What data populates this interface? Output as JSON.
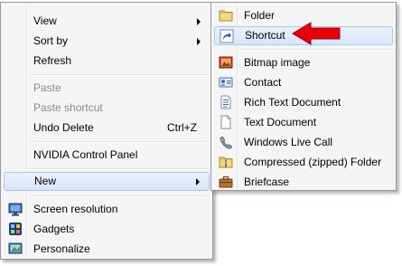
{
  "context_menu": {
    "items": [
      {
        "label": "View",
        "has_submenu": true
      },
      {
        "label": "Sort by",
        "has_submenu": true
      },
      {
        "label": "Refresh"
      },
      {
        "label": "Paste",
        "disabled": true
      },
      {
        "label": "Paste shortcut",
        "disabled": true
      },
      {
        "label": "Undo Delete",
        "shortcut": "Ctrl+Z"
      },
      {
        "label": "NVIDIA Control Panel"
      },
      {
        "label": "New",
        "has_submenu": true,
        "selected": true
      },
      {
        "label": "Screen resolution",
        "icon": "monitor-icon"
      },
      {
        "label": "Gadgets",
        "icon": "gadgets-icon"
      },
      {
        "label": "Personalize",
        "icon": "personalize-icon"
      }
    ]
  },
  "new_submenu": {
    "items": [
      {
        "label": "Folder",
        "icon": "folder-icon"
      },
      {
        "label": "Shortcut",
        "icon": "shortcut-icon",
        "selected": true
      },
      {
        "label": "Bitmap image",
        "icon": "bitmap-icon"
      },
      {
        "label": "Contact",
        "icon": "contact-icon"
      },
      {
        "label": "Rich Text Document",
        "icon": "rich-text-icon"
      },
      {
        "label": "Text Document",
        "icon": "text-document-icon"
      },
      {
        "label": "Windows Live Call",
        "icon": "phone-icon"
      },
      {
        "label": "Compressed (zipped) Folder",
        "icon": "zip-folder-icon"
      },
      {
        "label": "Briefcase",
        "icon": "briefcase-icon"
      }
    ]
  },
  "annotation": {
    "icon": "red-arrow-icon",
    "color": "#e8000b"
  },
  "colors": {
    "menu_bg": "#f5f5f5",
    "highlight": "#d6e6fb",
    "highlight_border": "#a8c8ef",
    "disabled_text": "#8a8a8a"
  }
}
